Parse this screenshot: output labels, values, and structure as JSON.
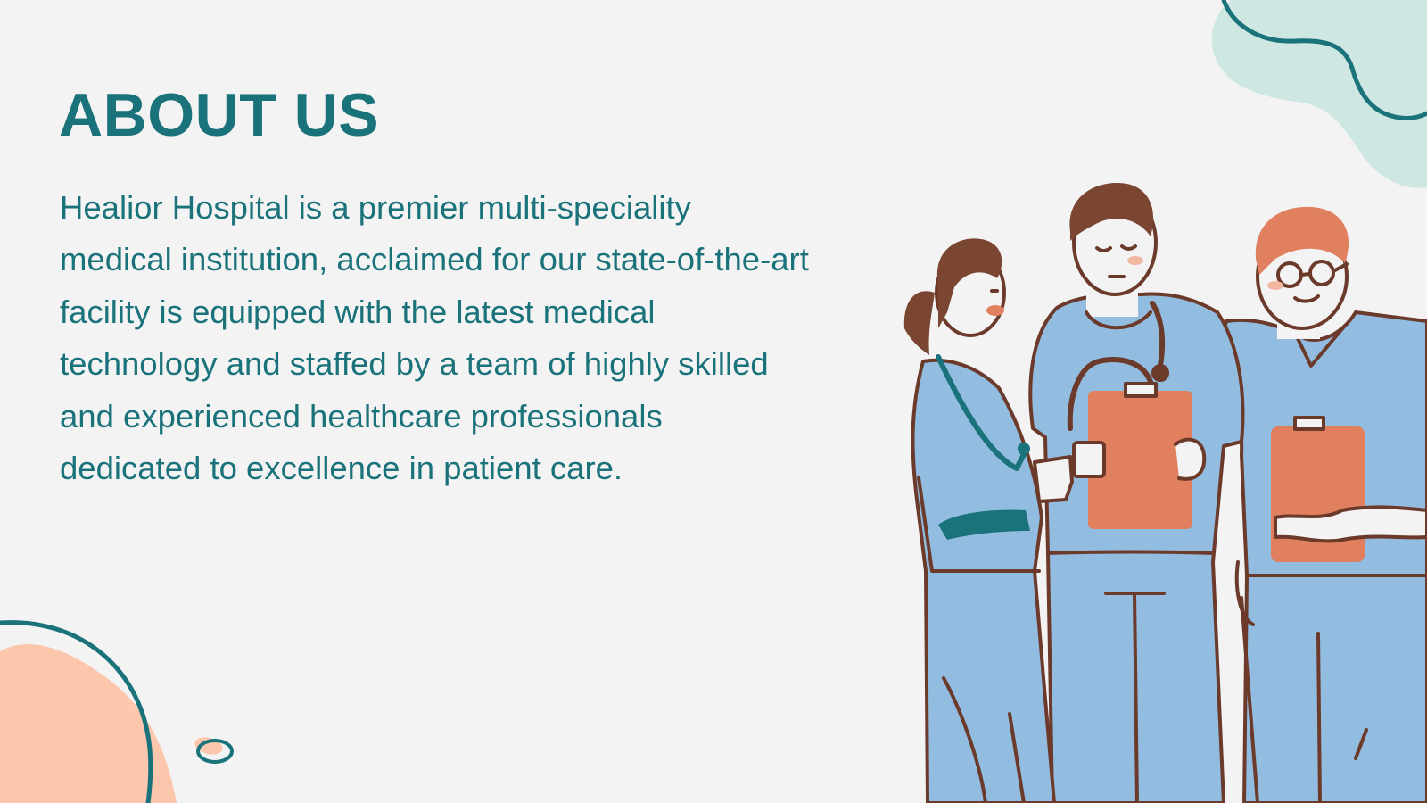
{
  "slide": {
    "title": "ABOUT US",
    "body": "Healior Hospital is a premier multi-speciality medical institution, acclaimed for our state-of-the-art facility is equipped with the latest medical technology and staffed by a team of highly skilled and experienced healthcare professionals dedicated to excellence in patient care."
  },
  "colors": {
    "background": "#f3f3f3",
    "teal": "#1a727a",
    "mint": "#cfe7e3",
    "peach": "#fdc7ad",
    "scrub_blue": "#92bde0",
    "clipboard_orange": "#e0805f",
    "hair_brown": "#7a4531",
    "hair_ginger": "#e0805f",
    "outline": "#6b3a2a"
  },
  "decorations": [
    "mint-blob",
    "teal-wave-line",
    "peach-blob",
    "teal-arc-line",
    "small-ring"
  ],
  "illustration": {
    "subject": "three healthcare workers in blue scrubs holding clipboards and a cup"
  }
}
